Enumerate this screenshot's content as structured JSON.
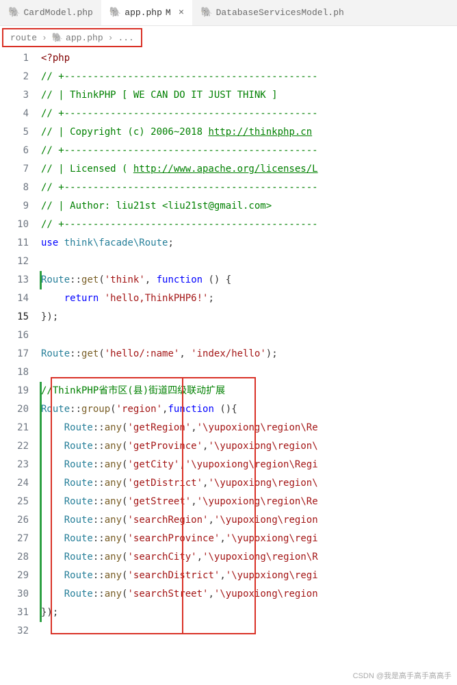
{
  "tabs": [
    {
      "icon": "🐘",
      "label": "CardModel.php",
      "active": false
    },
    {
      "icon": "🐘",
      "label": "app.php",
      "modified": "M",
      "active": true
    },
    {
      "icon": "🐘",
      "label": "DatabaseServicesModel.ph",
      "active": false
    }
  ],
  "breadcrumb": {
    "folder": "route",
    "file": "app.php",
    "more": "..."
  },
  "lines": [
    {
      "n": "1",
      "html": "<span class='tok-tag'>&lt;?php</span>"
    },
    {
      "n": "2",
      "html": "<span class='tok-comment'>// +--------------------------------------------</span>"
    },
    {
      "n": "3",
      "html": "<span class='tok-comment'>// | ThinkPHP [ WE CAN DO IT JUST THINK ]</span>"
    },
    {
      "n": "4",
      "html": "<span class='tok-comment'>// +--------------------------------------------</span>"
    },
    {
      "n": "5",
      "html": "<span class='tok-comment'>// | Copyright (c) 2006~2018 </span><span class='tok-link'>http://thinkphp.cn</span>"
    },
    {
      "n": "6",
      "html": "<span class='tok-comment'>// +--------------------------------------------</span>"
    },
    {
      "n": "7",
      "html": "<span class='tok-comment'>// | Licensed ( </span><span class='tok-link'>http://www.apache.org/licenses/L</span>"
    },
    {
      "n": "8",
      "html": "<span class='tok-comment'>// +--------------------------------------------</span>"
    },
    {
      "n": "9",
      "html": "<span class='tok-comment'>// | Author: liu21st &lt;liu21st@gmail.com&gt;</span>"
    },
    {
      "n": "10",
      "html": "<span class='tok-comment'>// +--------------------------------------------</span>"
    },
    {
      "n": "11",
      "html": "<span class='tok-keyword'>use</span> <span class='tok-class'>think\\facade\\Route</span>;"
    },
    {
      "n": "12",
      "html": ""
    },
    {
      "n": "13",
      "html": "<span class='tok-class'>Route</span>::<span class='tok-func'>get</span>(<span class='tok-string'>'think'</span>, <span class='tok-keyword'>function</span> () {"
    },
    {
      "n": "14",
      "html": "&nbsp;&nbsp;&nbsp;&nbsp;<span class='tok-keyword'>return</span> <span class='tok-string'>'hello,ThinkPHP6!'</span>;"
    },
    {
      "n": "15",
      "html": "});",
      "current": true
    },
    {
      "n": "16",
      "html": ""
    },
    {
      "n": "17",
      "html": "<span class='tok-class'>Route</span>::<span class='tok-func'>get</span>(<span class='tok-string'>'hello/:name'</span>, <span class='tok-string'>'index/hello'</span>);"
    },
    {
      "n": "18",
      "html": ""
    },
    {
      "n": "19",
      "html": "<span class='tok-comment'>//ThinkPHP省市区(县)街道四级联动扩展</span>"
    },
    {
      "n": "20",
      "html": "<span class='tok-class'>Route</span>::<span class='tok-func'>group</span>(<span class='tok-string'>'region'</span>,<span class='tok-keyword'>function</span> (){"
    },
    {
      "n": "21",
      "html": "&nbsp;&nbsp;&nbsp;&nbsp;<span class='tok-class'>Route</span>::<span class='tok-func'>any</span>(<span class='tok-string'>'getRegion'</span>,<span class='tok-string'>'\\yupoxiong\\region\\Re</span>"
    },
    {
      "n": "22",
      "html": "&nbsp;&nbsp;&nbsp;&nbsp;<span class='tok-class'>Route</span>::<span class='tok-func'>any</span>(<span class='tok-string'>'getProvince'</span>,<span class='tok-string'>'\\yupoxiong\\region\\</span>"
    },
    {
      "n": "23",
      "html": "&nbsp;&nbsp;&nbsp;&nbsp;<span class='tok-class'>Route</span>::<span class='tok-func'>any</span>(<span class='tok-string'>'getCity'</span>,<span class='tok-string'>'\\yupoxiong\\region\\Regi</span>"
    },
    {
      "n": "24",
      "html": "&nbsp;&nbsp;&nbsp;&nbsp;<span class='tok-class'>Route</span>::<span class='tok-func'>any</span>(<span class='tok-string'>'getDistrict'</span>,<span class='tok-string'>'\\yupoxiong\\region\\</span>"
    },
    {
      "n": "25",
      "html": "&nbsp;&nbsp;&nbsp;&nbsp;<span class='tok-class'>Route</span>::<span class='tok-func'>any</span>(<span class='tok-string'>'getStreet'</span>,<span class='tok-string'>'\\yupoxiong\\region\\Re</span>"
    },
    {
      "n": "26",
      "html": "&nbsp;&nbsp;&nbsp;&nbsp;<span class='tok-class'>Route</span>::<span class='tok-func'>any</span>(<span class='tok-string'>'searchRegion'</span>,<span class='tok-string'>'\\yupoxiong\\region</span>"
    },
    {
      "n": "27",
      "html": "&nbsp;&nbsp;&nbsp;&nbsp;<span class='tok-class'>Route</span>::<span class='tok-func'>any</span>(<span class='tok-string'>'searchProvince'</span>,<span class='tok-string'>'\\yupoxiong\\regi</span>"
    },
    {
      "n": "28",
      "html": "&nbsp;&nbsp;&nbsp;&nbsp;<span class='tok-class'>Route</span>::<span class='tok-func'>any</span>(<span class='tok-string'>'searchCity'</span>,<span class='tok-string'>'\\yupoxiong\\region\\R</span>"
    },
    {
      "n": "29",
      "html": "&nbsp;&nbsp;&nbsp;&nbsp;<span class='tok-class'>Route</span>::<span class='tok-func'>any</span>(<span class='tok-string'>'searchDistrict'</span>,<span class='tok-string'>'\\yupoxiong\\regi</span>"
    },
    {
      "n": "30",
      "html": "&nbsp;&nbsp;&nbsp;&nbsp;<span class='tok-class'>Route</span>::<span class='tok-func'>any</span>(<span class='tok-string'>'searchStreet'</span>,<span class='tok-string'>'\\yupoxiong\\region</span>"
    },
    {
      "n": "31",
      "html": "});"
    },
    {
      "n": "32",
      "html": ""
    }
  ],
  "watermark": "CSDN @我是高手高手高高手"
}
